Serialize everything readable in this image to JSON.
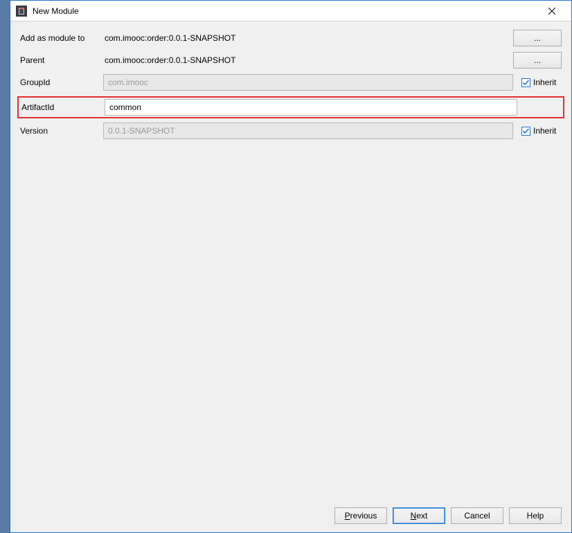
{
  "window": {
    "title": "New Module"
  },
  "form": {
    "add_as_module_label": "Add as module to",
    "add_as_module_value": "com.imooc:order:0.0.1-SNAPSHOT",
    "parent_label": "Parent",
    "parent_value": "com.imooc:order:0.0.1-SNAPSHOT",
    "groupid_label": "GroupId",
    "groupid_value": "com.imooc",
    "artifactid_label": "ArtifactId",
    "artifactid_value": "common",
    "version_label": "Version",
    "version_value": "0.0.1-SNAPSHOT",
    "inherit_label": "Inherit",
    "browse_label": "..."
  },
  "buttons": {
    "previous": "Previous",
    "next": "Next",
    "cancel": "Cancel",
    "help": "Help"
  }
}
